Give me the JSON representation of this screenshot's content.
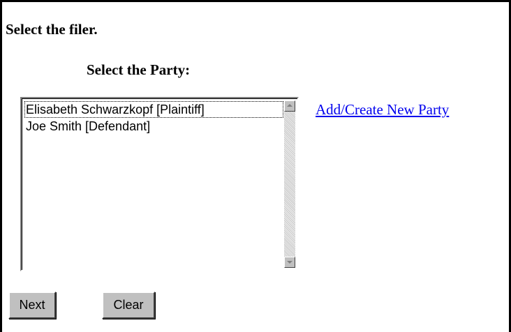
{
  "heading": "Select the filer.",
  "party_section": {
    "label": "Select the Party:",
    "options": [
      {
        "label": "Elisabeth Schwarzkopf [Plaintiff]",
        "selected": true
      },
      {
        "label": "Joe Smith [Defendant]",
        "selected": false
      }
    ]
  },
  "add_party_link": "Add/Create New Party",
  "buttons": {
    "next": "Next",
    "clear": "Clear"
  },
  "icons": {
    "scroll_up": "scroll-up-arrow-icon",
    "scroll_down": "scroll-down-arrow-icon"
  }
}
